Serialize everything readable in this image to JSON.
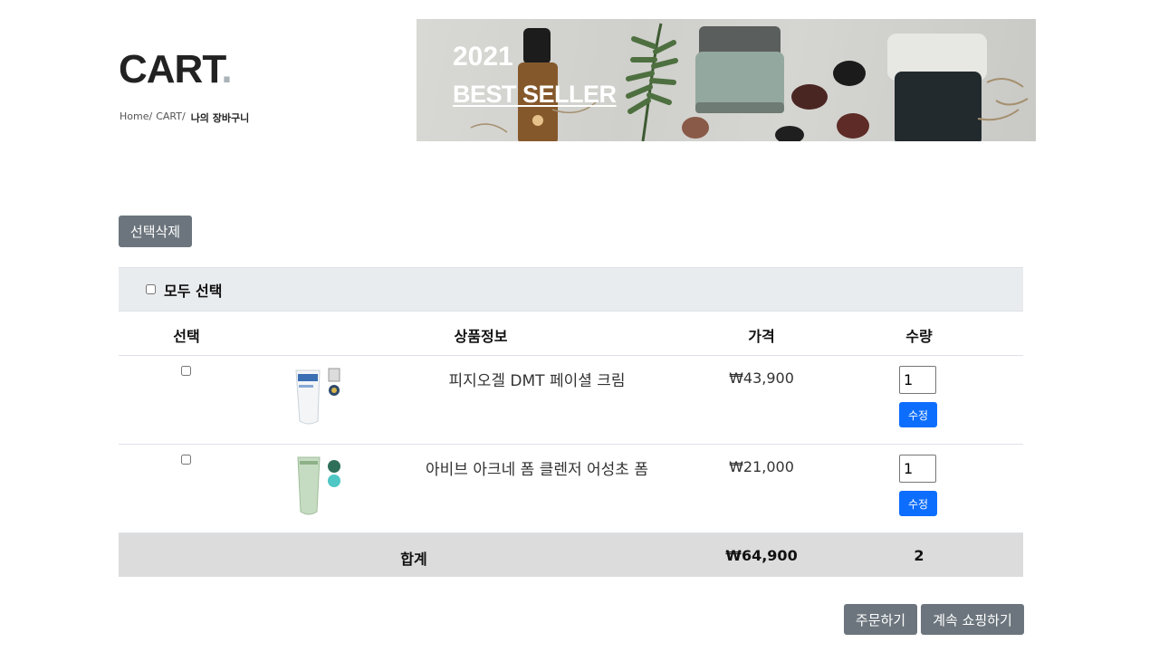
{
  "header": {
    "title": "CART",
    "title_dot": ".",
    "breadcrumb": [
      "Home/",
      "CART/",
      "나의 장바구니"
    ]
  },
  "banner": {
    "year": "2021",
    "label": "BEST SELLER"
  },
  "actions": {
    "delete_selected": "선택삭제",
    "order": "주문하기",
    "continue_shopping": "계속 쇼핑하기"
  },
  "table": {
    "select_all": "모두 선택",
    "columns": [
      "선택",
      "상품정보",
      "가격",
      "수량"
    ],
    "rows": [
      {
        "name": "피지오겔 DMT 페이셜 크림",
        "price": "₩43,900",
        "qty": "1",
        "edit": "수정",
        "thumb": "tube-cream-icon"
      },
      {
        "name": "아비브 아크네 폼 클렌저 어성초 폼",
        "price": "₩21,000",
        "qty": "1",
        "edit": "수정",
        "thumb": "tube-cleanser-icon"
      }
    ],
    "total": {
      "label": "합계",
      "price": "₩64,900",
      "count": "2"
    }
  },
  "colors": {
    "secondary_button": "#6c757d",
    "primary_button": "#0d6efd",
    "select_all_bg": "#e9ecef",
    "total_bg": "#dcdcdc"
  }
}
